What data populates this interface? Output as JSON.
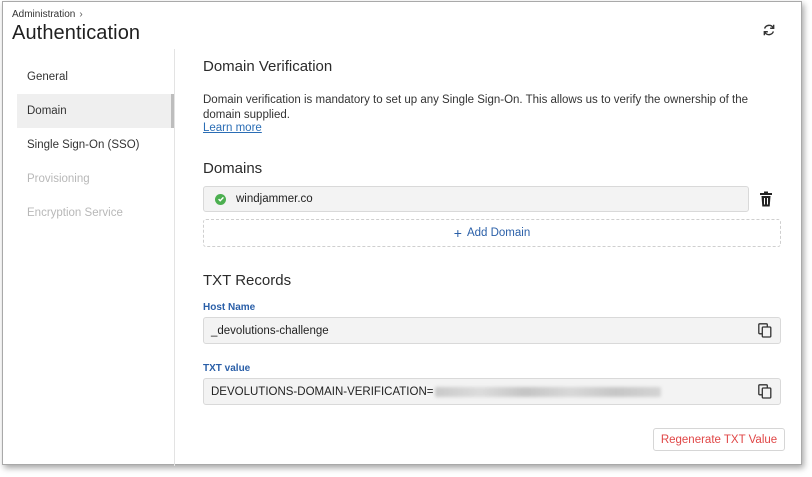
{
  "header": {
    "breadcrumb": "Administration",
    "title": "Authentication",
    "refresh_icon": "refresh-icon"
  },
  "sidebar": {
    "items": [
      {
        "label": "General",
        "state": "normal"
      },
      {
        "label": "Domain",
        "state": "active"
      },
      {
        "label": "Single Sign-On (SSO)",
        "state": "normal"
      },
      {
        "label": "Provisioning",
        "state": "disabled"
      },
      {
        "label": "Encryption Service",
        "state": "disabled"
      }
    ]
  },
  "main": {
    "section_title": "Domain Verification",
    "description": "Domain verification is mandatory to set up any Single Sign-On. This allows us to verify the ownership of the domain supplied.",
    "learn_more": "Learn more",
    "domains_title": "Domains",
    "domains": [
      {
        "name": "windjammer.co",
        "verified": true
      }
    ],
    "add_domain_label": "Add Domain",
    "txt_title": "TXT Records",
    "host_name_label": "Host Name",
    "host_name_value": "_devolutions-challenge",
    "txt_value_label": "TXT value",
    "txt_value_prefix": "DEVOLUTIONS-DOMAIN-VERIFICATION=",
    "regenerate_label": "Regenerate TXT Value"
  },
  "colors": {
    "accent_blue": "#2a5fa8",
    "link_blue": "#2a6db5",
    "success_green": "#4caf50",
    "danger_red": "#e04646"
  }
}
